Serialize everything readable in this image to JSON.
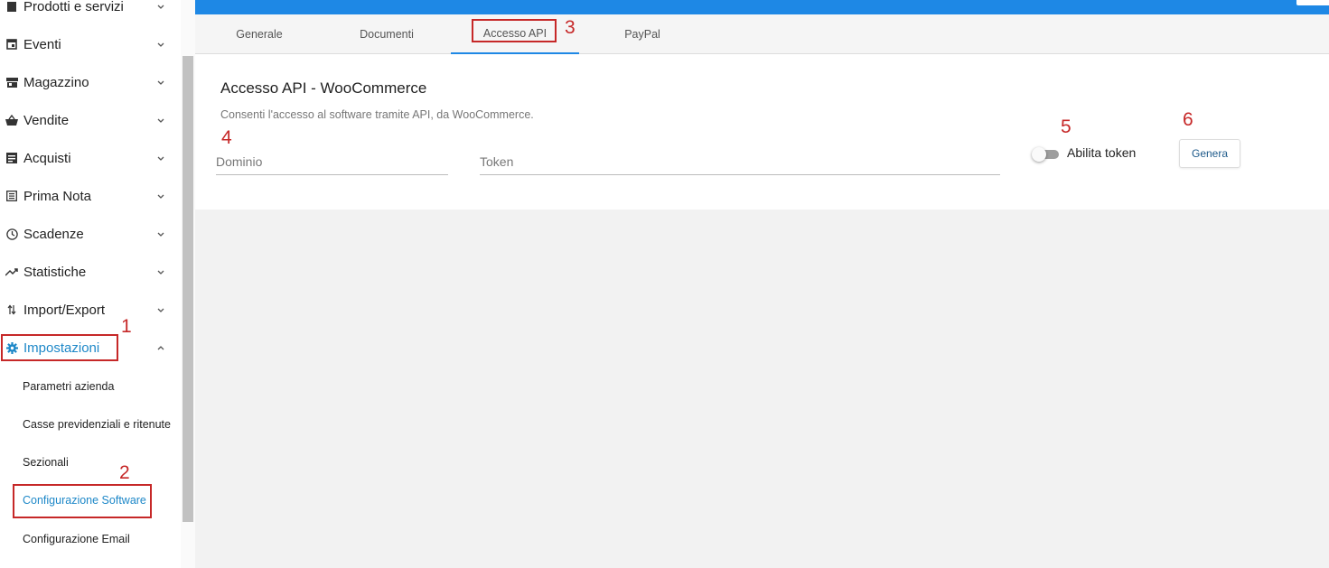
{
  "sidebar": {
    "items": [
      {
        "label": "Prodotti e servizi",
        "icon": "box-icon"
      },
      {
        "label": "Eventi",
        "icon": "calendar-icon"
      },
      {
        "label": "Magazzino",
        "icon": "store-icon"
      },
      {
        "label": "Vendite",
        "icon": "basket-icon"
      },
      {
        "label": "Acquisti",
        "icon": "receipt-icon"
      },
      {
        "label": "Prima Nota",
        "icon": "notebook-icon"
      },
      {
        "label": "Scadenze",
        "icon": "clock-icon"
      },
      {
        "label": "Statistiche",
        "icon": "trending-icon"
      },
      {
        "label": "Import/Export",
        "icon": "swap-icon"
      },
      {
        "label": "Impostazioni",
        "icon": "gear-icon"
      }
    ],
    "sub_items": [
      {
        "label": "Parametri azienda"
      },
      {
        "label": "Casse previdenziali e ritenute"
      },
      {
        "label": "Sezionali"
      },
      {
        "label": "Configurazione Software"
      },
      {
        "label": "Configurazione Email"
      }
    ]
  },
  "tabs": [
    {
      "label": "Generale"
    },
    {
      "label": "Documenti"
    },
    {
      "label": "Accesso API"
    },
    {
      "label": "PayPal"
    }
  ],
  "card": {
    "title": "Accesso API - WooCommerce",
    "description": "Consenti l'accesso al software tramite API, da WooCommerce.",
    "dominio_placeholder": "Dominio",
    "dominio_value": "",
    "token_placeholder": "Token",
    "token_value": "",
    "toggle_label": "Abilita token",
    "toggle_on": false,
    "generate_label": "Genera"
  },
  "annotations": [
    "1",
    "2",
    "3",
    "4",
    "5",
    "6"
  ],
  "colors": {
    "accent": "#1e88e5",
    "annotation": "#c62828",
    "active_text": "#1e88c8"
  }
}
